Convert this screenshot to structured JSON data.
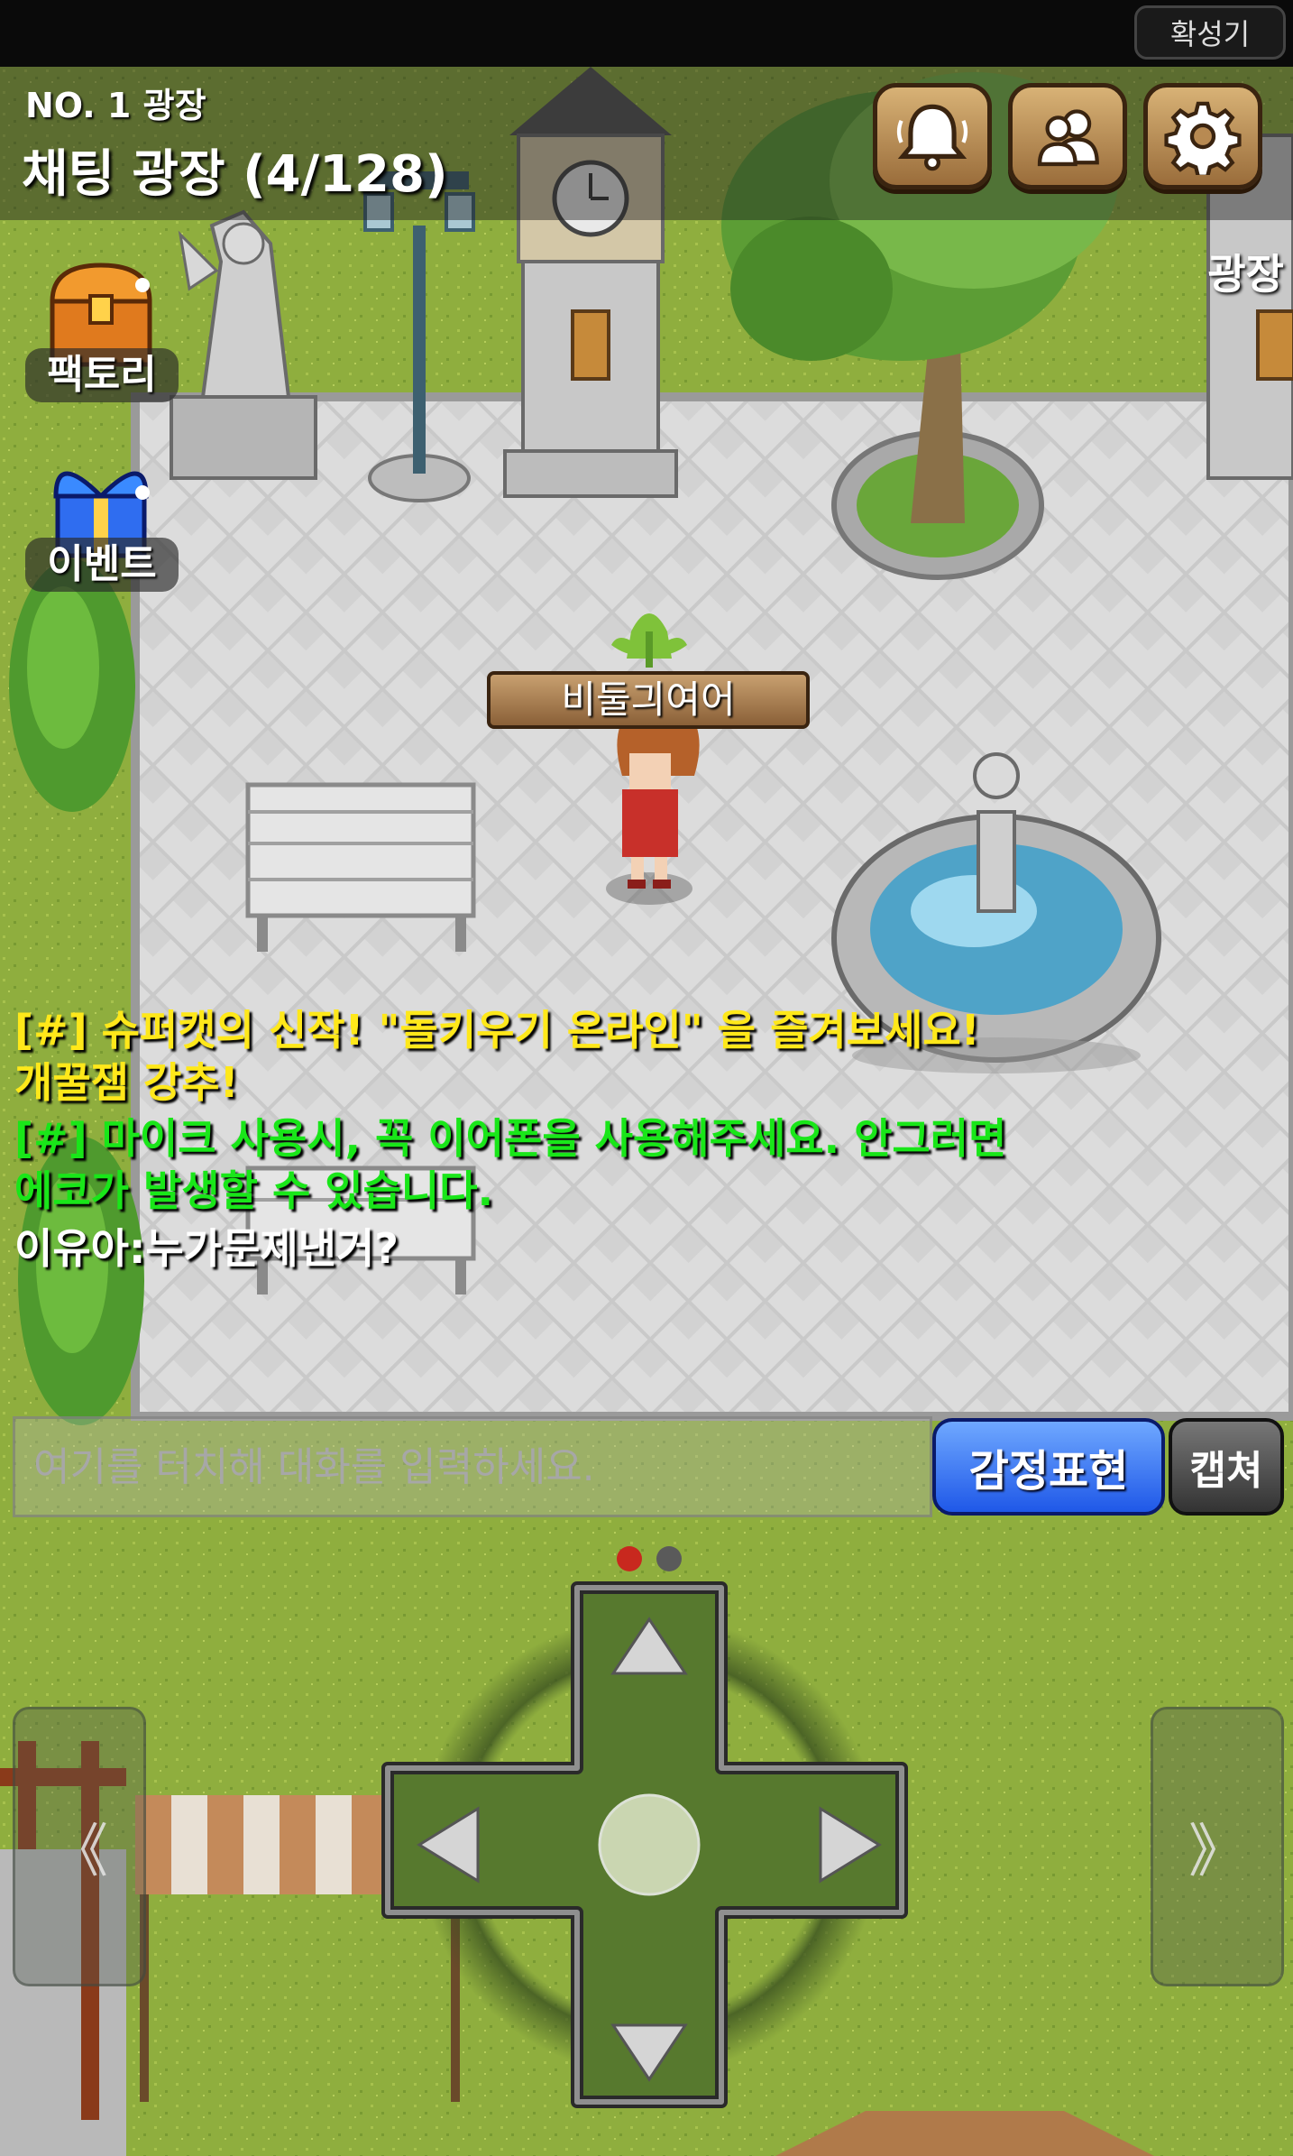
{
  "status": {
    "megaphone_label": "확성기"
  },
  "header": {
    "plaza_number": "NO. 1 광장",
    "room_title": "채팅 광장 (4/128)",
    "area_label": "광장"
  },
  "header_buttons": [
    {
      "icon": "bell-icon"
    },
    {
      "icon": "friends-icon"
    },
    {
      "icon": "gear-icon"
    }
  ],
  "side_menu": [
    {
      "label": "팩토리",
      "icon": "treasure-chest-icon"
    },
    {
      "label": "이벤트",
      "icon": "gift-box-icon"
    }
  ],
  "player": {
    "name": "비둘긔여어"
  },
  "chat": {
    "lines": [
      {
        "text": "[#] 슈퍼캣의 신작! \"돌키우기 온라인\" 을 즐겨보세요!",
        "color": "#ffe81a"
      },
      {
        "text": "개꿀잼 강추!",
        "color": "#ffe81a"
      },
      {
        "text": "[#] 마이크 사용시, 꼭 이어폰을 사용해주세요. 안그러면",
        "color": "#19e619"
      },
      {
        "text": "에코가 발생할 수 있습니다.",
        "color": "#19e619"
      },
      {
        "text": "이유아:누가문제낸거?",
        "color": "#ffffff"
      }
    ],
    "input_placeholder": "여기를 터치해 대화를 입력하세요.",
    "emote_label": "감정표현",
    "capture_label": "캡쳐"
  },
  "controls": {
    "page_indicator": {
      "current": 1,
      "total": 2
    },
    "prev_label": "《",
    "next_label": "》",
    "dpad": [
      "up-arrow-icon",
      "down-arrow-icon",
      "left-arrow-icon",
      "right-arrow-icon"
    ]
  },
  "colors": {
    "system_notice": "#ffe81a",
    "system_tip": "#19e619",
    "user_chat": "#ffffff",
    "emote_button": "#2f6df0",
    "header_button": "#b88a52",
    "page_dot_active": "#c8281e",
    "page_dot_inactive": "#5a5a5a"
  }
}
